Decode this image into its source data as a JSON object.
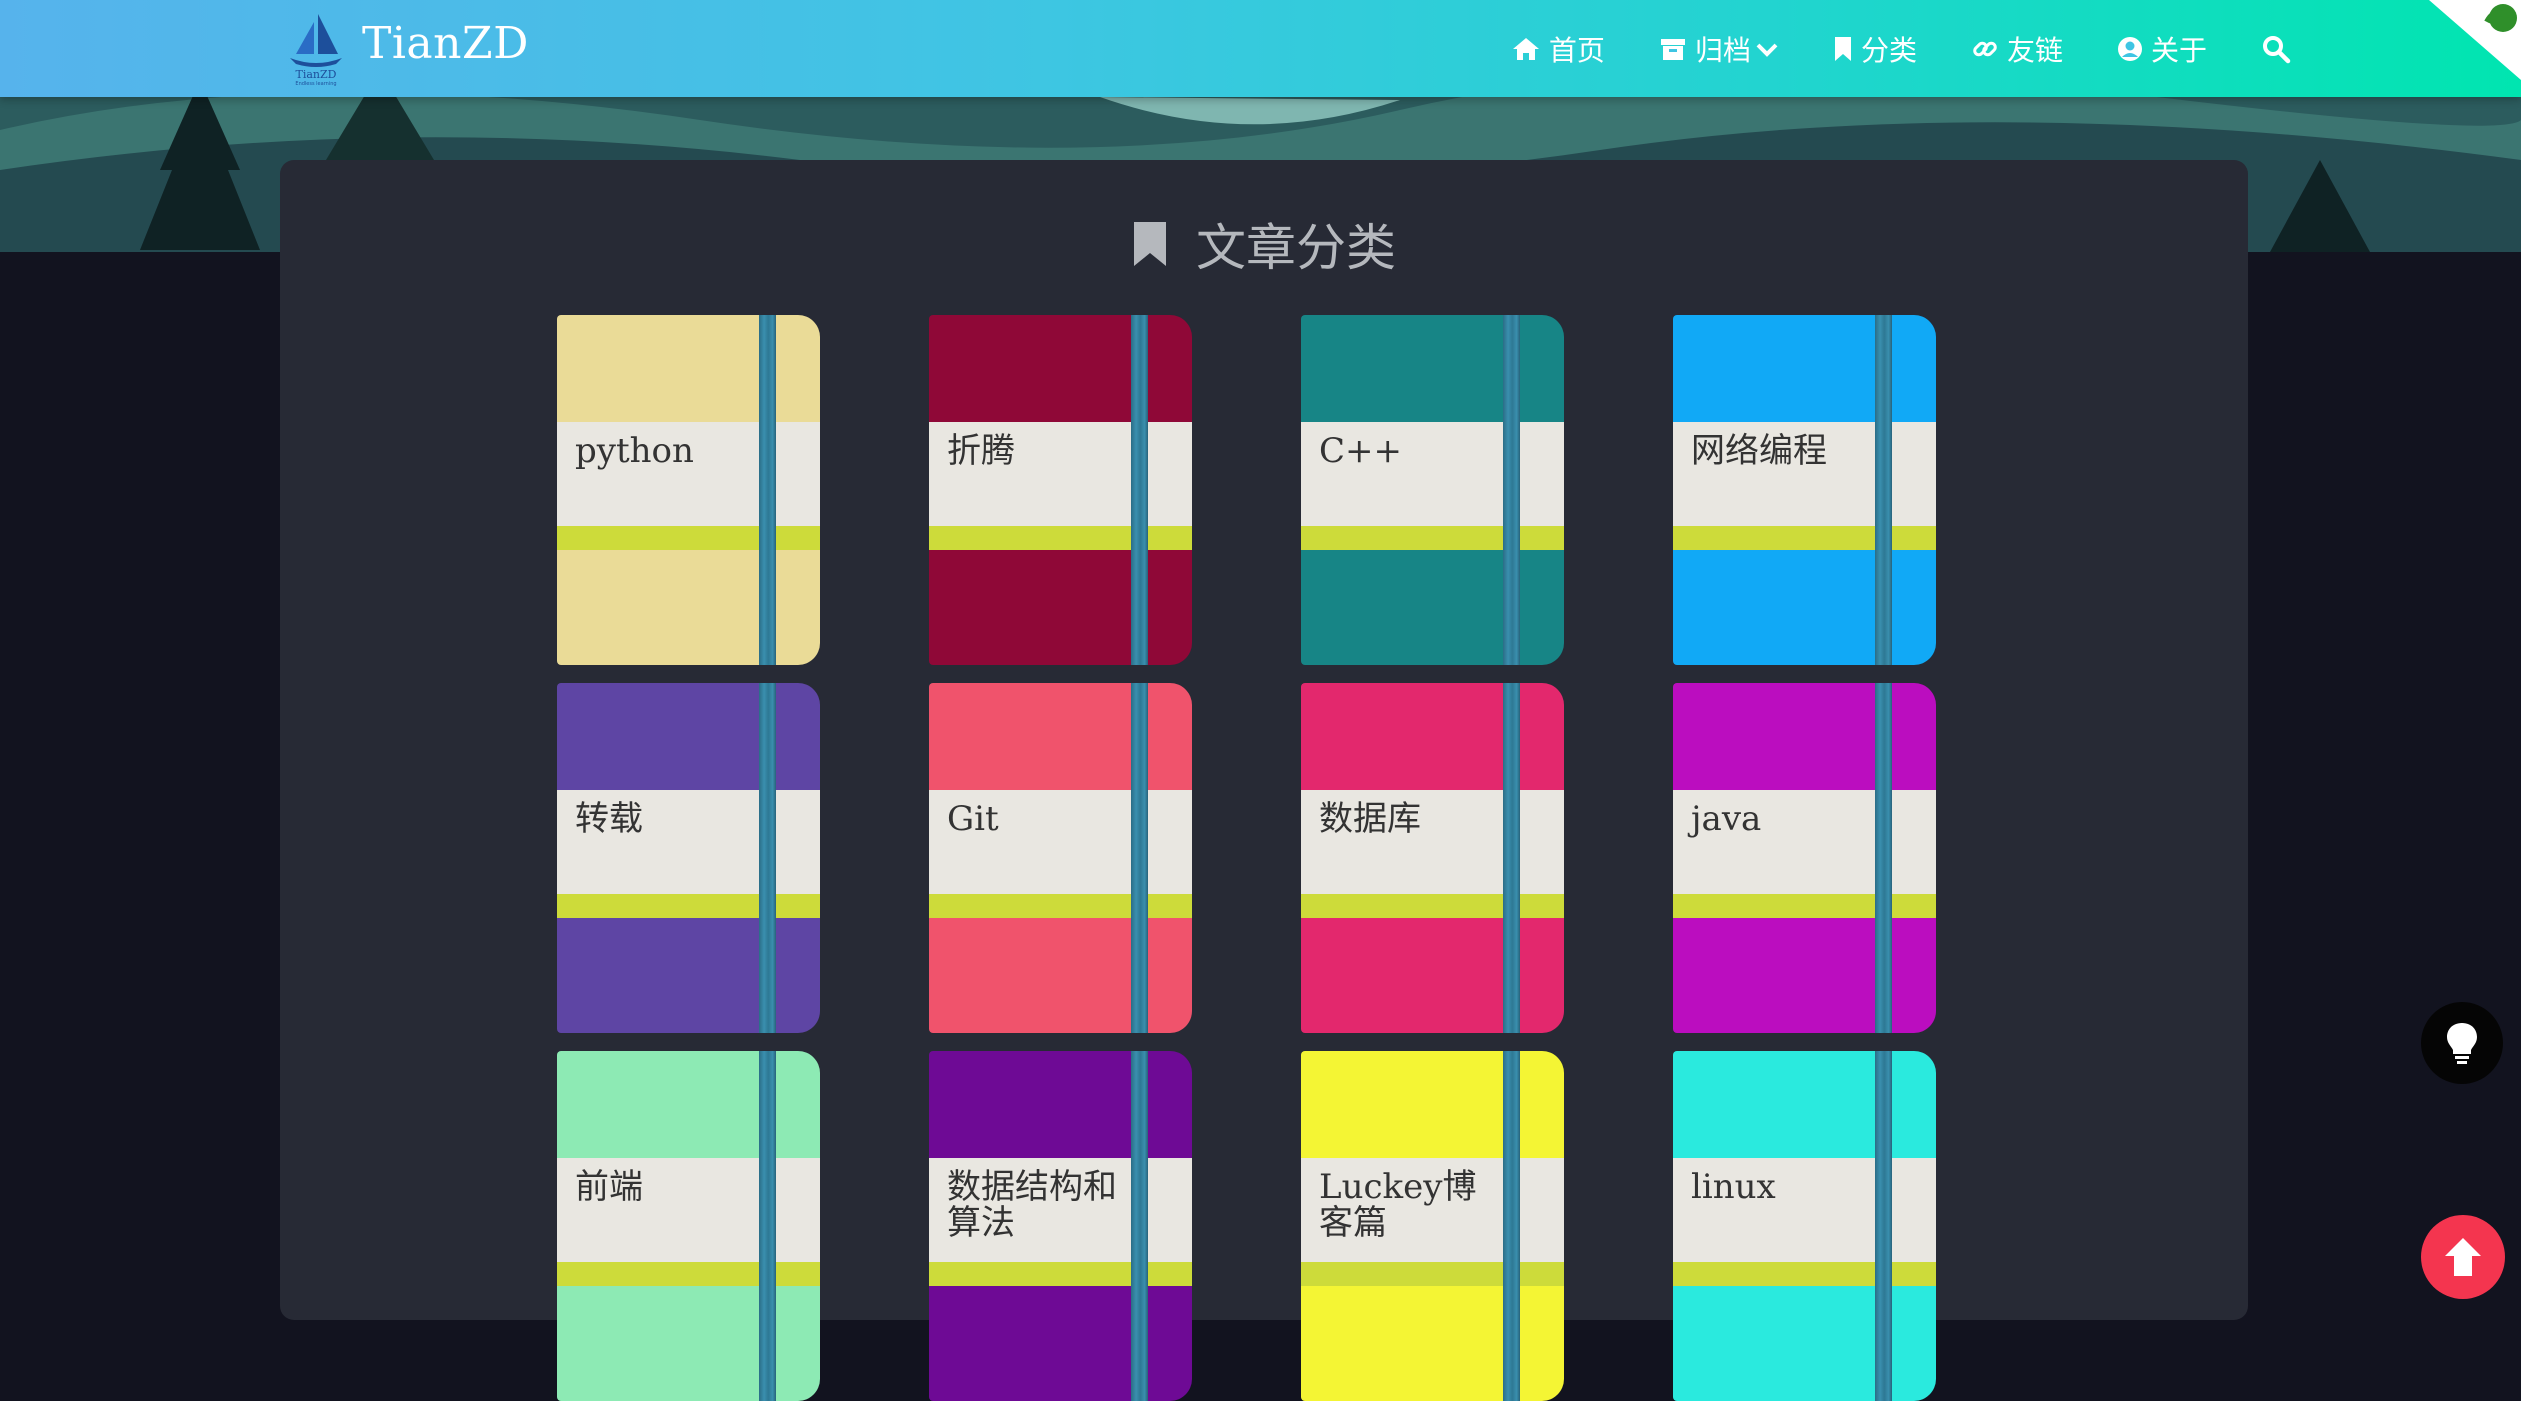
{
  "brand": {
    "name": "TianZD",
    "logo_text": "TianZD",
    "logo_sub": "Endless learning"
  },
  "nav": {
    "items": [
      {
        "label": "首页",
        "icon": "home-icon"
      },
      {
        "label": "归档",
        "icon": "archive-icon",
        "has_dropdown": true
      },
      {
        "label": "分类",
        "icon": "bookmark-icon"
      },
      {
        "label": "友链",
        "icon": "link-icon"
      },
      {
        "label": "关于",
        "icon": "user-circle-icon"
      }
    ],
    "search_icon": "search-icon"
  },
  "page": {
    "title": "文章分类",
    "title_icon": "bookmark-icon"
  },
  "categories": [
    {
      "name": "python",
      "color": "#eadb97"
    },
    {
      "name": "折腾",
      "color": "#8f0837"
    },
    {
      "name": "C++",
      "color": "#178586"
    },
    {
      "name": "网络编程",
      "color": "#11a9f6"
    },
    {
      "name": "转载",
      "color": "#5e45a4"
    },
    {
      "name": "Git",
      "color": "#f0536c"
    },
    {
      "name": "数据库",
      "color": "#e3286d"
    },
    {
      "name": "java",
      "color": "#bb0dbf"
    },
    {
      "name": "前端",
      "color": "#8deab4"
    },
    {
      "name": "数据结构和算法",
      "color": "#6e0a95"
    },
    {
      "name": "Luckey博客篇",
      "color": "#f4f534"
    },
    {
      "name": "linux",
      "color": "#2aeade"
    }
  ],
  "floating": {
    "theme_icon": "lightbulb-icon",
    "top_icon": "arrow-up-icon"
  },
  "colors": {
    "band": "#e9e7e1",
    "stripe": "#cddb3a",
    "strap": "#2e7894",
    "card": "#272a35"
  }
}
